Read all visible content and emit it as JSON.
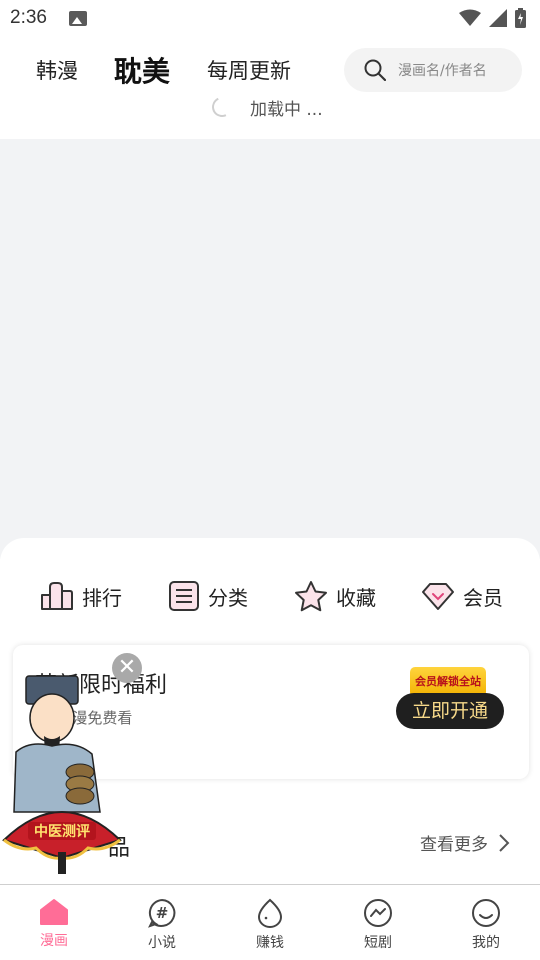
{
  "status_bar": {
    "time": "2:36",
    "icons": [
      "image-icon",
      "wifi-icon",
      "signal-icon",
      "battery-icon"
    ]
  },
  "top_nav": {
    "tabs": [
      {
        "label": "韩漫",
        "active": false
      },
      {
        "label": "耽美",
        "active": true
      },
      {
        "label": "每周更新",
        "active": false
      }
    ],
    "search_placeholder": "漫画名/作者名"
  },
  "loading": {
    "text": "加载中 ..."
  },
  "quick_actions": [
    {
      "label": "排行",
      "icon": "ranking-icon"
    },
    {
      "label": "分类",
      "icon": "category-list-icon"
    },
    {
      "label": "收藏",
      "icon": "star-icon"
    },
    {
      "label": "会员",
      "icon": "diamond-icon"
    }
  ],
  "promo": {
    "title": "萌新限时福利",
    "subtitle": "K+国漫免费看",
    "badge": "会员解锁全站",
    "button": "立即开通"
  },
  "floating_ad": {
    "label": "中医测评"
  },
  "section": {
    "title": "品",
    "more": "查看更多"
  },
  "bottom_nav": [
    {
      "label": "漫画",
      "active": true
    },
    {
      "label": "小说",
      "active": false
    },
    {
      "label": "赚钱",
      "active": false
    },
    {
      "label": "短剧",
      "active": false
    },
    {
      "label": "我的",
      "active": false
    }
  ],
  "colors": {
    "accent": "#ff6d97",
    "page_bg": "#f2f3f5",
    "button_dark": "#1f1f1f",
    "gold": "#f7d98a"
  }
}
